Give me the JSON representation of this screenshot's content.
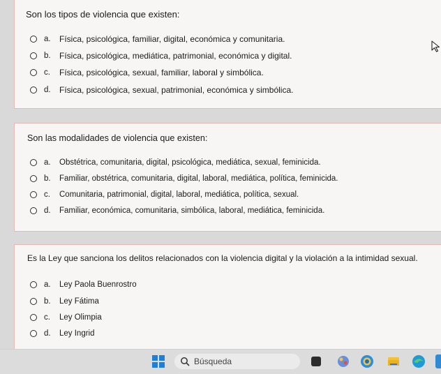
{
  "questions": [
    {
      "prompt": "Son los tipos de violencia que existen:",
      "options": [
        {
          "letter": "a.",
          "text": "Física, psicológica, familiar, digital, económica y comunitaria."
        },
        {
          "letter": "b.",
          "text": "Física, psicológica, mediática, patrimonial, económica y digital."
        },
        {
          "letter": "c.",
          "text": "Física, psicológica, sexual, familiar, laboral y simbólica."
        },
        {
          "letter": "d.",
          "text": "Física, psicológica, sexual, patrimonial, económica y simbólica."
        }
      ]
    },
    {
      "prompt": "Son las modalidades de violencia que existen:",
      "options": [
        {
          "letter": "a.",
          "text": "Obstétrica, comunitaria, digital, psicológica, mediática, sexual, feminicida."
        },
        {
          "letter": "b.",
          "text": "Familiar, obstétrica, comunitaria, digital, laboral, mediática, política, feminicida."
        },
        {
          "letter": "c.",
          "text": "Comunitaria, patrimonial, digital, laboral, mediática, política, sexual."
        },
        {
          "letter": "d.",
          "text": "Familiar, económica, comunitaria, simbólica, laboral, mediática, feminicida."
        }
      ]
    },
    {
      "prompt": "Es la Ley que sanciona los delitos relacionados con la violencia digital y la violación a la intimidad sexual.",
      "options": [
        {
          "letter": "a.",
          "text": "Ley Paola Buenrostro"
        },
        {
          "letter": "b.",
          "text": "Ley Fátima"
        },
        {
          "letter": "c.",
          "text": "Ley Olimpia"
        },
        {
          "letter": "d.",
          "text": "Ley Ingrid"
        }
      ]
    }
  ],
  "taskbar": {
    "search_placeholder": "Búsqueda",
    "icons": [
      "windows-start-icon",
      "search-icon",
      "file-icon",
      "paint-icon",
      "chrome-icon",
      "folder-icon",
      "edge-icon"
    ]
  },
  "colors": {
    "card_border": "#e6b7b3",
    "card_bg": "#f7f6f4",
    "taskbar_bg": "#dcdcdc",
    "windows_blue": "#1d80d8"
  }
}
